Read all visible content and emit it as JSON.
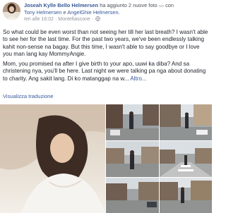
{
  "post": {
    "author": "Joseah Kylle Bello Helmersen",
    "action_text": "ha aggiunto 2 nuove foto",
    "with_text": "— con",
    "tagged_1": "Tony Helmersen",
    "conj": "e",
    "tagged_2": "AngelGhie Helmersen.",
    "time": "Ieri alle 16:02",
    "separator": "·",
    "location": "Montefiascone",
    "location_sep": "·",
    "paragraph_1": "So what could be even worst than not seeing her till her last breath? I wasn't able to see her for the last time. For the past two years, we've been endlessly talking kahit non-sense na bagay. But this time, I wasn't able to say goodbye or I love you man lang kay MommyAngie.",
    "paragraph_2": "Mom, you promised na after I give birth to your apo, uuwi ka diba? And sa christening nya, you'll be here. Last night we were talking pa nga about donating to charity. Ang sakit lang. Di ko matanggap na w...",
    "more_link": "Altro...",
    "translate_link": "Visualizza traduzione"
  },
  "icons": {
    "avatar": "avatar",
    "globe": "globe-icon"
  },
  "colors": {
    "link": "#365899",
    "text": "#1d2129",
    "meta": "#90949c"
  }
}
